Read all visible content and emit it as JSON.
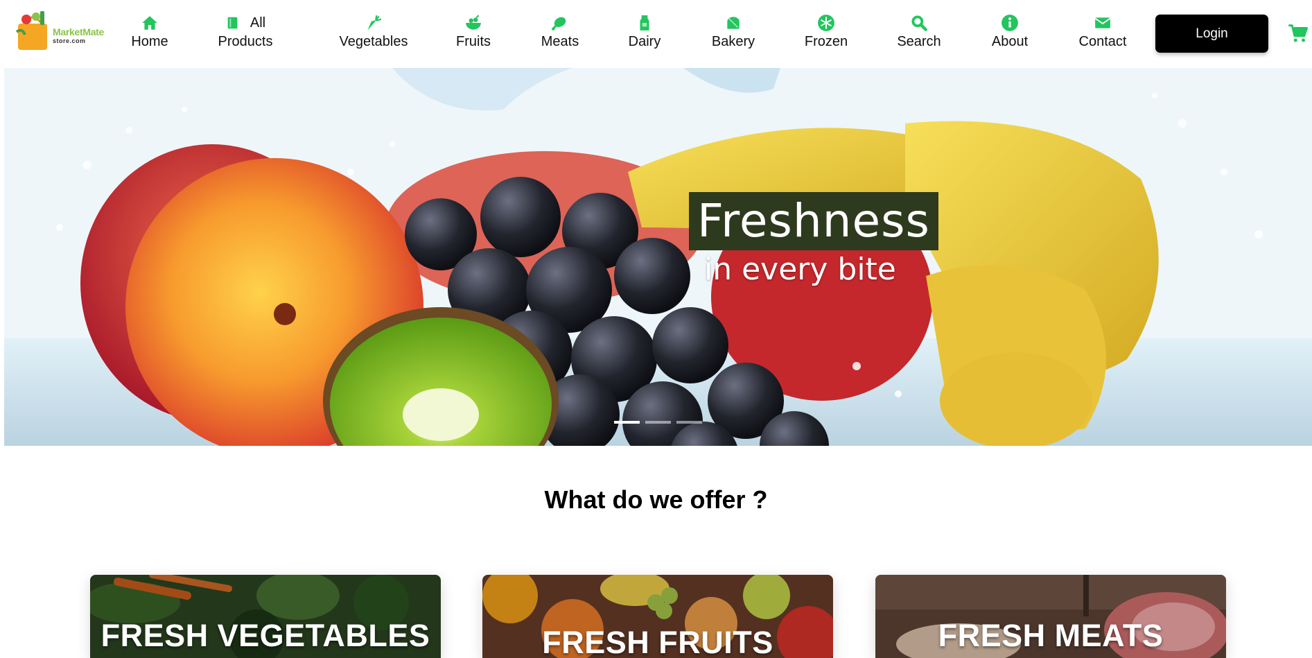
{
  "logo": {
    "brand": "MarketMate",
    "domain": "store.com"
  },
  "nav": {
    "items": [
      {
        "icon": "home-icon",
        "label": "Home"
      },
      {
        "icon": "book-icon",
        "label_line1": "All",
        "label_line2": "Products"
      },
      {
        "icon": "carrot-icon",
        "label": "Vegetables"
      },
      {
        "icon": "fruit-bowl-icon",
        "label": "Fruits"
      },
      {
        "icon": "meat-icon",
        "label": "Meats"
      },
      {
        "icon": "milk-icon",
        "label": "Dairy"
      },
      {
        "icon": "bread-icon",
        "label": "Bakery"
      },
      {
        "icon": "snowflake-icon",
        "label": "Frozen"
      },
      {
        "icon": "search-icon",
        "label": "Search"
      },
      {
        "icon": "info-icon",
        "label": "About"
      },
      {
        "icon": "mail-icon",
        "label": "Contact"
      }
    ],
    "login_label": "Login",
    "cart_icon": "cart-icon"
  },
  "hero": {
    "title": "Freshness",
    "subtitle": "in every bite",
    "slides": 3,
    "active_slide": 1
  },
  "offer": {
    "title": "What do we offer ?",
    "cards": [
      {
        "title": "FRESH VEGETABLES"
      },
      {
        "title": "FRESH FRUITS"
      },
      {
        "title": "FRESH MEATS"
      }
    ]
  },
  "colors": {
    "accent": "#22c55e",
    "brand_green": "#8bc34a",
    "login_bg": "#000000",
    "hero_title_bg": "#2e3a1e"
  }
}
